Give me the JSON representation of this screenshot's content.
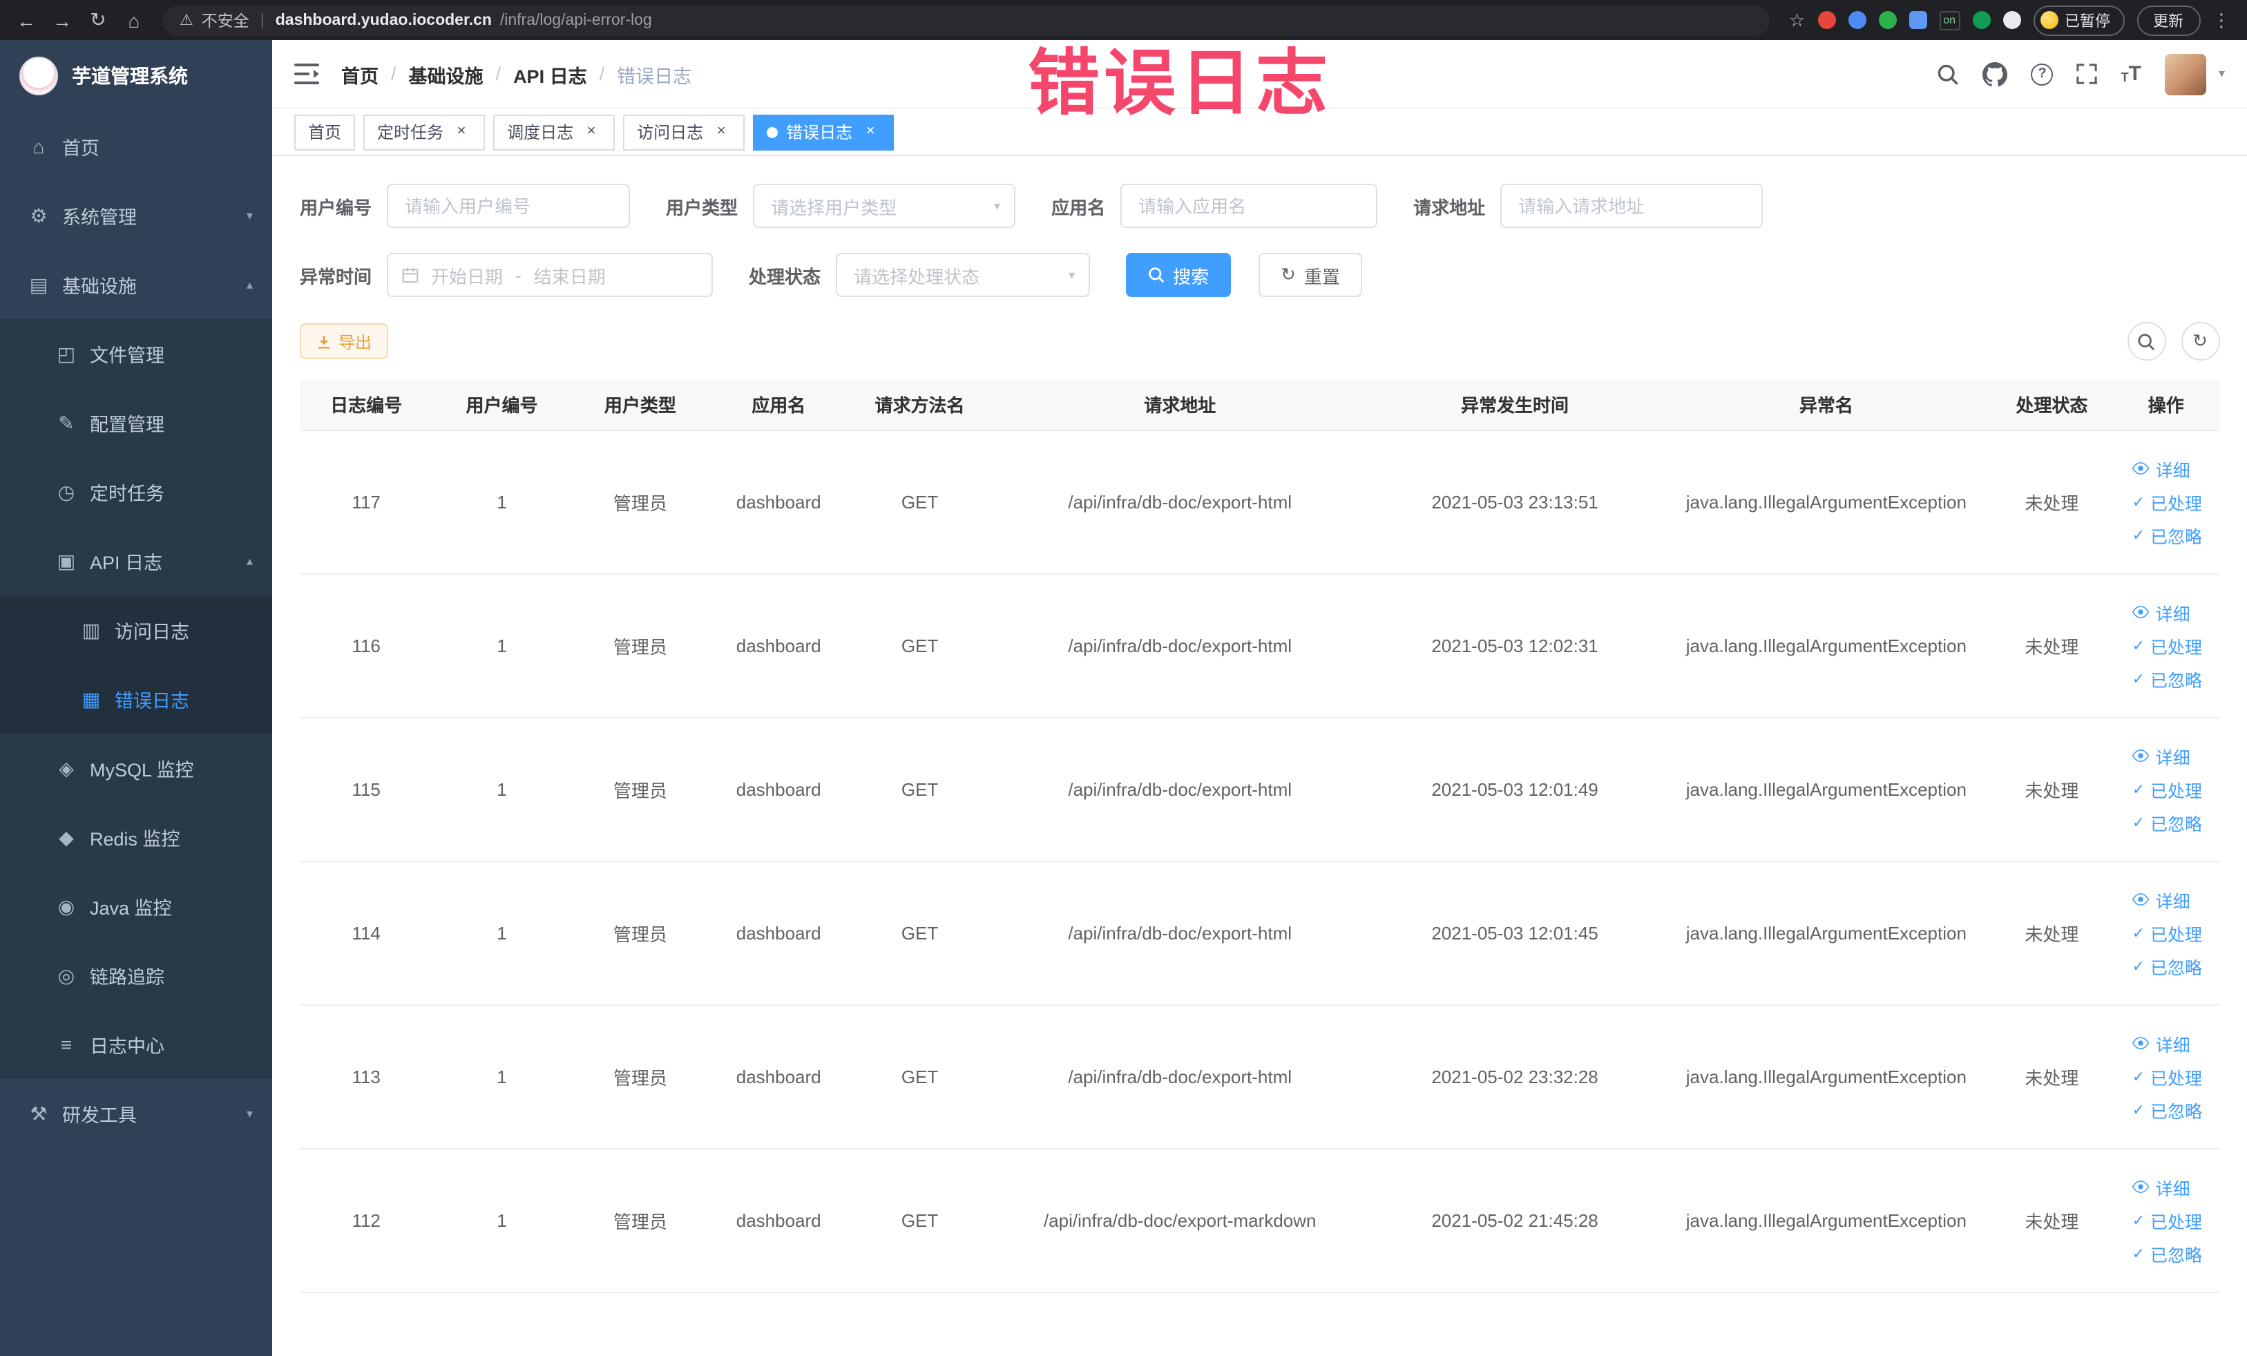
{
  "colors": {
    "primary": "#409EFF",
    "sidebar_bg": "#304156",
    "warning_text": "#e6a23c",
    "overlay_red": "#f5466b"
  },
  "browser": {
    "security_label": "不安全",
    "url_domain": "dashboard.yudao.iocoder.cn",
    "url_path": "/infra/log/api-error-log",
    "extension_on_badge": "on",
    "paused_badge": "已暂停",
    "update_button": "更新"
  },
  "overlay": {
    "title": "错误日志"
  },
  "sidebar": {
    "logo_title": "芋道管理系统",
    "items": [
      {
        "label": "首页"
      },
      {
        "label": "系统管理"
      },
      {
        "label": "基础设施"
      },
      {
        "label": "文件管理"
      },
      {
        "label": "配置管理"
      },
      {
        "label": "定时任务"
      },
      {
        "label": "API 日志"
      },
      {
        "label": "访问日志"
      },
      {
        "label": "错误日志"
      },
      {
        "label": "MySQL 监控"
      },
      {
        "label": "Redis 监控"
      },
      {
        "label": "Java 监控"
      },
      {
        "label": "链路追踪"
      },
      {
        "label": "日志中心"
      },
      {
        "label": "研发工具"
      }
    ]
  },
  "breadcrumb": {
    "separator": "/",
    "items": [
      "首页",
      "基础设施",
      "API 日志",
      "错误日志"
    ]
  },
  "tabs": [
    {
      "label": "首页"
    },
    {
      "label": "定时任务"
    },
    {
      "label": "调度日志"
    },
    {
      "label": "访问日志"
    },
    {
      "label": "错误日志"
    }
  ],
  "filters": {
    "user_id": {
      "label": "用户编号",
      "placeholder": "请输入用户编号"
    },
    "user_type": {
      "label": "用户类型",
      "placeholder": "请选择用户类型"
    },
    "app_name": {
      "label": "应用名",
      "placeholder": "请输入应用名"
    },
    "request_url": {
      "label": "请求地址",
      "placeholder": "请输入请求地址"
    },
    "exception_time": {
      "label": "异常时间",
      "start_placeholder": "开始日期",
      "separator": "-",
      "end_placeholder": "结束日期"
    },
    "process_status": {
      "label": "处理状态",
      "placeholder": "请选择处理状态"
    },
    "search_button": "搜索",
    "reset_button": "重置"
  },
  "toolbar": {
    "export_button": "导出"
  },
  "table": {
    "columns": [
      "日志编号",
      "用户编号",
      "用户类型",
      "应用名",
      "请求方法名",
      "请求地址",
      "异常发生时间",
      "异常名",
      "处理状态",
      "操作"
    ],
    "actions": {
      "detail": "详细",
      "processed": "已处理",
      "ignored": "已忽略"
    },
    "rows": [
      {
        "id": "117",
        "user_id": "1",
        "user_type": "管理员",
        "app": "dashboard",
        "method": "GET",
        "url": "/api/infra/db-doc/export-html",
        "time": "2021-05-03 23:13:51",
        "exception": "java.lang.IllegalArgumentException",
        "status": "未处理"
      },
      {
        "id": "116",
        "user_id": "1",
        "user_type": "管理员",
        "app": "dashboard",
        "method": "GET",
        "url": "/api/infra/db-doc/export-html",
        "time": "2021-05-03 12:02:31",
        "exception": "java.lang.IllegalArgumentException",
        "status": "未处理"
      },
      {
        "id": "115",
        "user_id": "1",
        "user_type": "管理员",
        "app": "dashboard",
        "method": "GET",
        "url": "/api/infra/db-doc/export-html",
        "time": "2021-05-03 12:01:49",
        "exception": "java.lang.IllegalArgumentException",
        "status": "未处理"
      },
      {
        "id": "114",
        "user_id": "1",
        "user_type": "管理员",
        "app": "dashboard",
        "method": "GET",
        "url": "/api/infra/db-doc/export-html",
        "time": "2021-05-03 12:01:45",
        "exception": "java.lang.IllegalArgumentException",
        "status": "未处理"
      },
      {
        "id": "113",
        "user_id": "1",
        "user_type": "管理员",
        "app": "dashboard",
        "method": "GET",
        "url": "/api/infra/db-doc/export-html",
        "time": "2021-05-02 23:32:28",
        "exception": "java.lang.IllegalArgumentException",
        "status": "未处理"
      },
      {
        "id": "112",
        "user_id": "1",
        "user_type": "管理员",
        "app": "dashboard",
        "method": "GET",
        "url": "/api/infra/db-doc/export-markdown",
        "time": "2021-05-02 21:45:28",
        "exception": "java.lang.IllegalArgumentException",
        "status": "未处理"
      }
    ]
  }
}
